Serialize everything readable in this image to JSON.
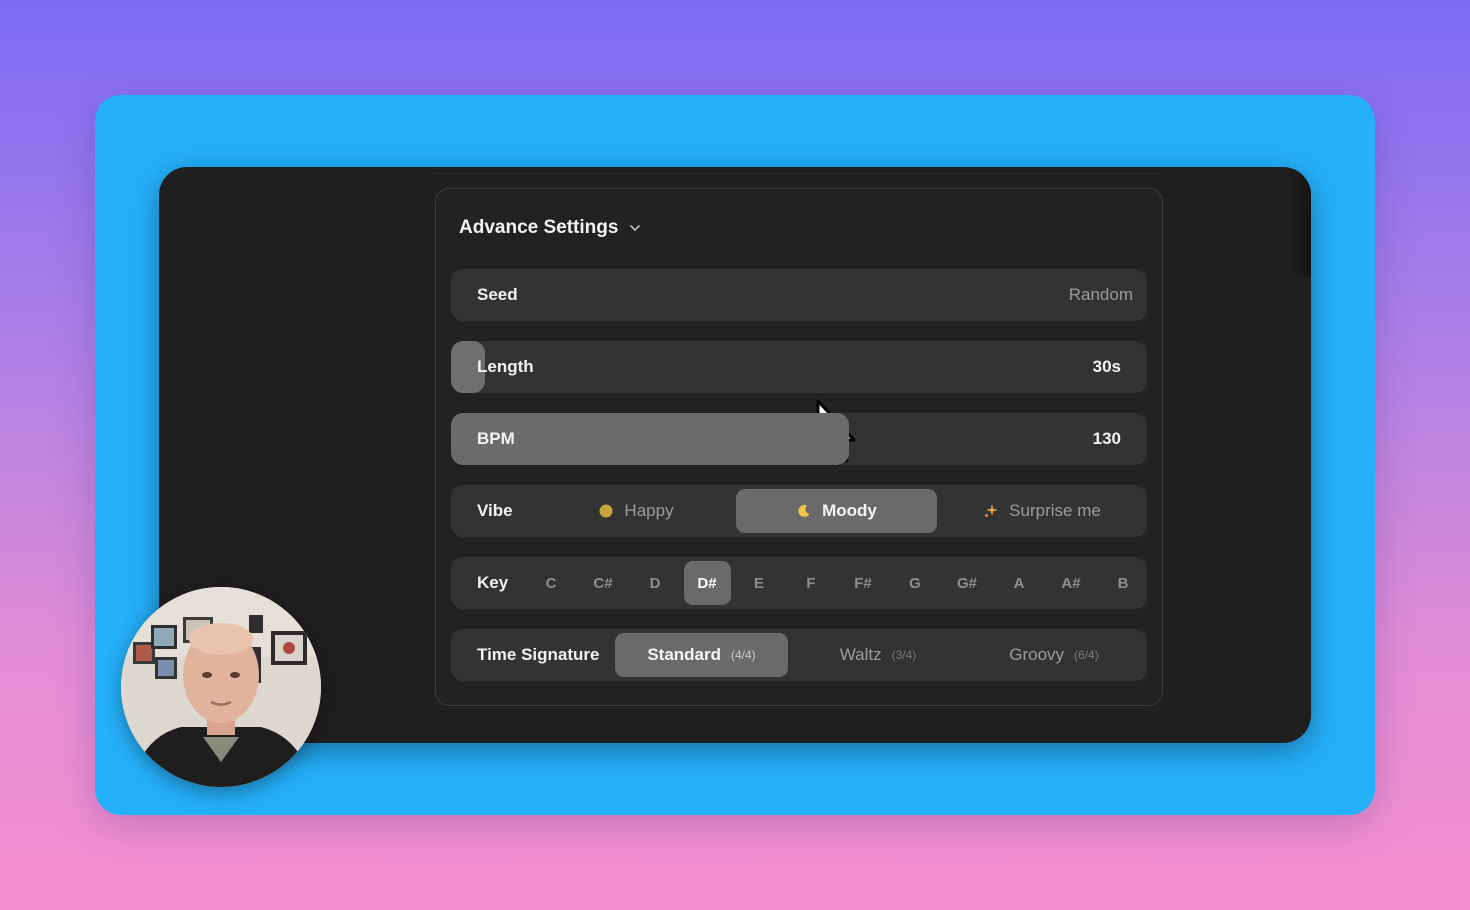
{
  "panel": {
    "title": "Advance Settings",
    "expanded": true
  },
  "seed": {
    "label": "Seed",
    "value": "Random"
  },
  "length": {
    "label": "Length",
    "value": "30s",
    "slider_fraction": 0.0
  },
  "bpm": {
    "label": "BPM",
    "value": "130",
    "slider_fraction": 0.55
  },
  "vibe": {
    "label": "Vibe",
    "selected": "Moody",
    "options": [
      {
        "label": "Happy",
        "icon": "sun-icon"
      },
      {
        "label": "Moody",
        "icon": "moon-icon"
      },
      {
        "label": "Surprise me",
        "icon": "sparkle-icon"
      }
    ]
  },
  "key": {
    "label": "Key",
    "selected": "D#",
    "options": [
      "C",
      "C#",
      "D",
      "D#",
      "E",
      "F",
      "F#",
      "G",
      "G#",
      "A",
      "A#",
      "B"
    ]
  },
  "time_signature": {
    "label": "Time Signature",
    "selected": "Standard",
    "options": [
      {
        "label": "Standard",
        "sub": "(4/4)"
      },
      {
        "label": "Waltz",
        "sub": "(3/4)"
      },
      {
        "label": "Groovy",
        "sub": "(6/4)"
      }
    ]
  },
  "colors": {
    "background_top": "#7d6cf6",
    "background_bottom": "#f590cf",
    "card": "#25b0fa",
    "window": "#1f1f1f",
    "row": "#333333",
    "active": "#6a6a6a"
  }
}
